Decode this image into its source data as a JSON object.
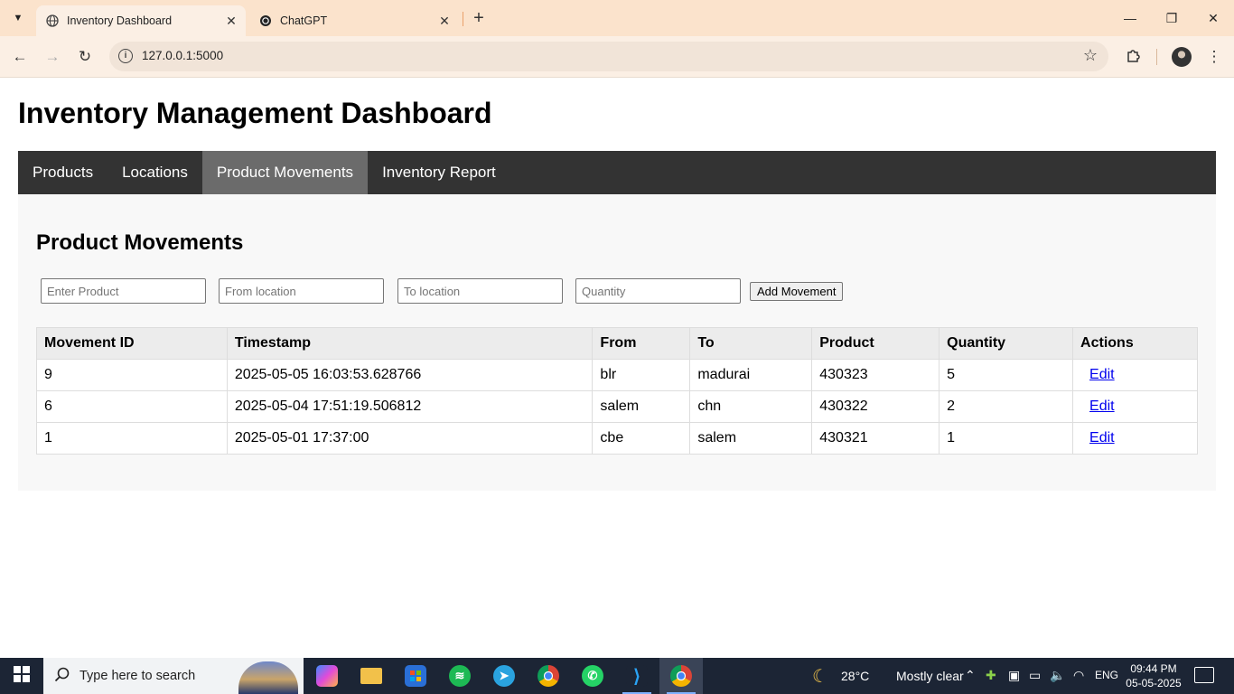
{
  "browser": {
    "tabs": [
      {
        "title": "Inventory Dashboard",
        "active": true
      },
      {
        "title": "ChatGPT",
        "active": false
      }
    ],
    "url": "127.0.0.1:5000"
  },
  "page": {
    "title": "Inventory Management Dashboard",
    "nav": [
      {
        "label": "Products",
        "active": false
      },
      {
        "label": "Locations",
        "active": false
      },
      {
        "label": "Product Movements",
        "active": true
      },
      {
        "label": "Inventory Report",
        "active": false
      }
    ],
    "section_title": "Product Movements",
    "form": {
      "product_placeholder": "Enter Product",
      "from_placeholder": "From location",
      "to_placeholder": "To location",
      "quantity_placeholder": "Quantity",
      "submit_label": "Add Movement"
    },
    "table": {
      "headers": [
        "Movement ID",
        "Timestamp",
        "From",
        "To",
        "Product",
        "Quantity",
        "Actions"
      ],
      "rows": [
        {
          "id": "9",
          "timestamp": "2025-05-05 16:03:53.628766",
          "from": "blr",
          "to": "madurai",
          "product": "430323",
          "quantity": "5",
          "action": "Edit"
        },
        {
          "id": "6",
          "timestamp": "2025-05-04 17:51:19.506812",
          "from": "salem",
          "to": "chn",
          "product": "430322",
          "quantity": "2",
          "action": "Edit"
        },
        {
          "id": "1",
          "timestamp": "2025-05-01 17:37:00",
          "from": "cbe",
          "to": "salem",
          "product": "430321",
          "quantity": "1",
          "action": "Edit"
        }
      ]
    }
  },
  "taskbar": {
    "search_placeholder": "Type here to search",
    "weather": {
      "temp": "28°C",
      "condition": "Mostly clear"
    },
    "language": "ENG",
    "time": "09:44 PM",
    "date": "05-05-2025"
  },
  "colors": {
    "tabstrip": "#fbe3cc",
    "navbar": "#333333",
    "nav_active": "#6b6b6b",
    "link": "#0000ee",
    "taskbar": "#1c2535"
  }
}
